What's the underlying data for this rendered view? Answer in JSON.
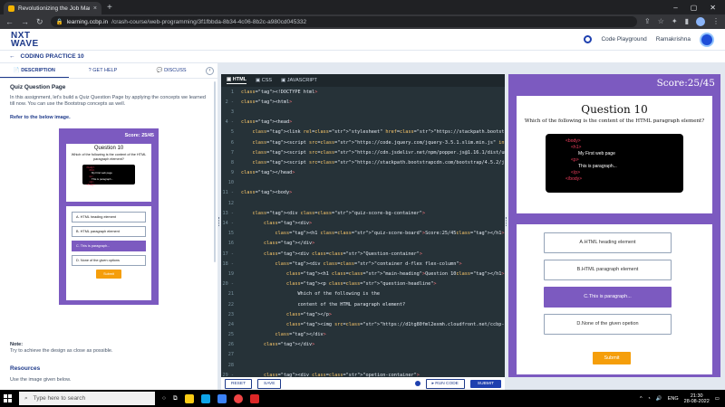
{
  "browser": {
    "tab_title": "Revolutionizing the Job Market | N",
    "url_host": "learning.ccbp.in",
    "url_path": "/crash-course/web-programming/3f1fbbda-8b34-4c06-8b2c-a980cd045332"
  },
  "header": {
    "logo_line1": "NXT",
    "logo_line2": "WAVE",
    "code_playground": "Code Playground",
    "username": "Ramakrishna"
  },
  "practice": {
    "back": "←",
    "title": "CODING PRACTICE 10"
  },
  "left": {
    "tabs": [
      "DESCRIPTION",
      "GET HELP",
      "DISCUSS"
    ],
    "collapse": "‹",
    "heading": "Quiz Question Page",
    "intro": "In this assignment, let's build a Quiz Question Page by applying the concepts we learned till now. You can use the Bootstrap concepts as well.",
    "refer": "Refer to the below image.",
    "note_title": "Note:",
    "note_text": "Try to achieve the design as close as possible.",
    "resources": "Resources",
    "resources_text": "Use the image given below."
  },
  "editor": {
    "tabs": [
      "HTML",
      "CSS",
      "JAVASCRIPT"
    ],
    "reset": "RESET",
    "save": "SAVE",
    "run": "▸ RUN CODE",
    "submit": "SUBMIT"
  },
  "preview": {
    "score": "Score:25/45",
    "question_heading": "Question 10",
    "question_text": "Which of the following is the content of the HTML paragraph element?",
    "img_lines": [
      "<body>",
      "<h1>",
      "My First web page",
      "<p>",
      "This is paragraph...",
      "</p>",
      "</body>"
    ],
    "options": [
      "A.HTML heading element",
      "B.HTML paragraph element",
      "C.This is paragraph...",
      "D.None of the given opetion"
    ],
    "selected_index": 2,
    "submit": "Submit"
  },
  "mini": {
    "score": "Score: 25/45",
    "question_heading": "Question 10",
    "question_text": "Which of the following is the content of the HTML paragraph element?",
    "img_lines": [
      "<body>",
      "<h1>",
      "My First web page",
      "<p>",
      "This is paragraph...",
      "</p>",
      "</body>"
    ],
    "options": [
      "A. HTML heading element",
      "B. HTML paragraph element",
      "C. This is paragraph...",
      "D. None of the given options"
    ],
    "selected_index": 2,
    "submit": "Submit"
  },
  "code_lines": [
    {
      "n": "1",
      "t": "<!DOCTYPE html>"
    },
    {
      "n": "2 -",
      "t": "<html>"
    },
    {
      "n": "3",
      "t": ""
    },
    {
      "n": "4 -",
      "t": "<head>"
    },
    {
      "n": "5",
      "t": "    <link rel=\"stylesheet\" href=\"https://stackpath.bootstrapcdn.com/bootstrap/4.5.2/c"
    },
    {
      "n": "6",
      "t": "    <script src=\"https://code.jquery.com/jquery-3.5.1.slim.min.js\" integrity=\"sha384-D"
    },
    {
      "n": "7",
      "t": "    <script src=\"https://cdn.jsdelivr.net/npm/popper.js@1.16.1/dist/umd/popper.min.js\""
    },
    {
      "n": "8",
      "t": "    <script src=\"https://stackpath.bootstrapcdn.com/bootstrap/4.5.2/js/bootstrap.min.j"
    },
    {
      "n": "9",
      "t": "</head>"
    },
    {
      "n": "10",
      "t": ""
    },
    {
      "n": "11 -",
      "t": "<body>"
    },
    {
      "n": "12",
      "t": ""
    },
    {
      "n": "13 -",
      "t": "    <div class=\"quiz-score-bg-container\">"
    },
    {
      "n": "14 -",
      "t": "        <div>"
    },
    {
      "n": "15",
      "t": "            <h1 class=\"quiz-score-board\">Score:25/45</h1>"
    },
    {
      "n": "16",
      "t": "        </div>"
    },
    {
      "n": "17 -",
      "t": "        <div class=\"Question-container\">"
    },
    {
      "n": "18 -",
      "t": "            <div class=\"container d-flex flex-column\">"
    },
    {
      "n": "19",
      "t": "                <h1 class=\"main-heading\">Question 10</h1>"
    },
    {
      "n": "20 -",
      "t": "                <p class=\"question-headline\">"
    },
    {
      "n": "21",
      "t": "                    Which of the following is the"
    },
    {
      "n": "22",
      "t": "                    content of the HTML paragraph element?"
    },
    {
      "n": "23",
      "t": "                </p>"
    },
    {
      "n": "24",
      "t": "                <img src=\"https://d1tg80fml2exmh.cloudfront.net/ccbp-static-website/cc"
    },
    {
      "n": "25",
      "t": "            </div>"
    },
    {
      "n": "26",
      "t": "        </div>"
    },
    {
      "n": "27",
      "t": ""
    },
    {
      "n": "28",
      "t": ""
    },
    {
      "n": "29 -",
      "t": "        <div class=\"opetion-container\">"
    }
  ],
  "taskbar": {
    "search": "Type here to search",
    "lang": "ENG",
    "time": "21:30",
    "date": "28-08-2022"
  }
}
